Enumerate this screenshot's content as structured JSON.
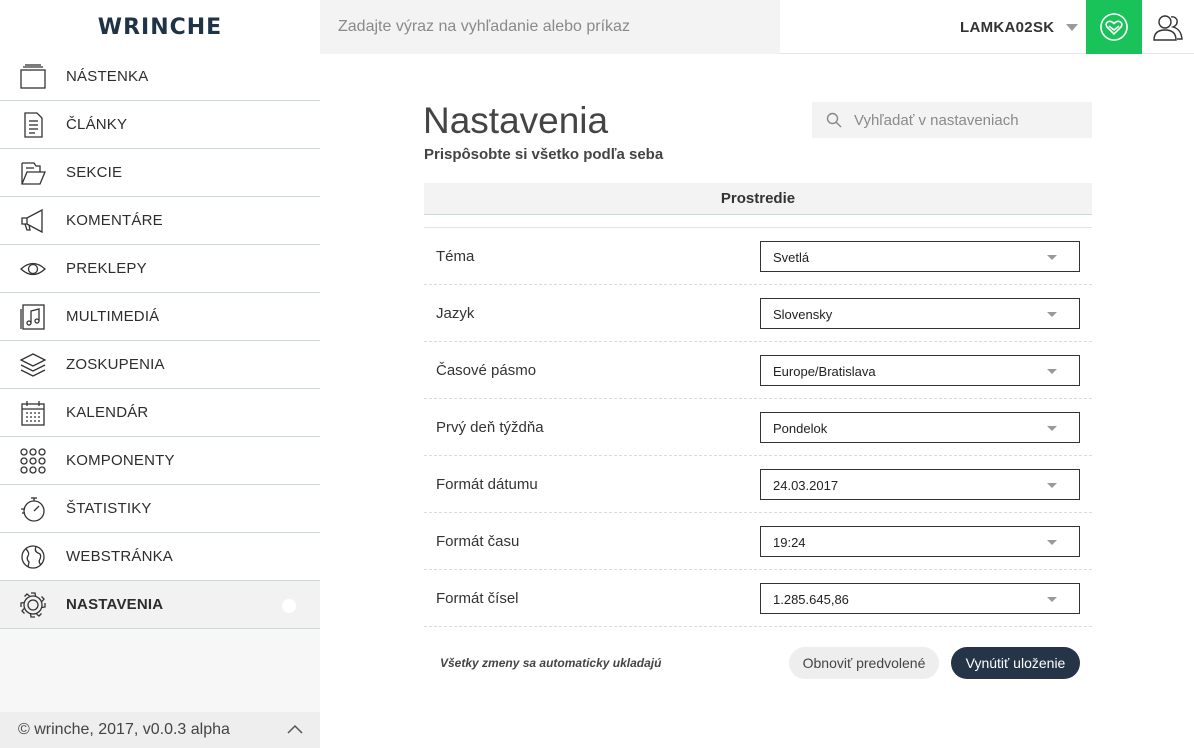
{
  "header": {
    "logo": "WRINCHE",
    "command_placeholder": "Zadajte výraz na vyhľadanie alebo príkaz",
    "username": "LAMKA02SK",
    "brand_button_icon": "heart-shield-icon",
    "profile_icon": "user-icon",
    "accent_color": "#19c35a"
  },
  "sidebar": {
    "items": [
      {
        "label": "NÁSTENKA",
        "icon": "dashboard-icon"
      },
      {
        "label": "ČLÁNKY",
        "icon": "document-icon"
      },
      {
        "label": "SEKCIE",
        "icon": "folder-icon"
      },
      {
        "label": "KOMENTÁRE",
        "icon": "megaphone-icon"
      },
      {
        "label": "PREKLEPY",
        "icon": "eye-icon"
      },
      {
        "label": "MULTIMEDIÁ",
        "icon": "music-icon"
      },
      {
        "label": "ZOSKUPENIA",
        "icon": "layers-icon"
      },
      {
        "label": "KALENDÁR",
        "icon": "calendar-icon"
      },
      {
        "label": "KOMPONENTY",
        "icon": "grid-dots-icon"
      },
      {
        "label": "ŠTATISTIKY",
        "icon": "stopwatch-icon"
      },
      {
        "label": "WEBSTRÁNKA",
        "icon": "globe-icon"
      },
      {
        "label": "NASTAVENIA",
        "icon": "gear-icon",
        "active": true
      }
    ],
    "footer": "© wrinche, 2017, v0.0.3 alpha"
  },
  "settings": {
    "title": "Nastavenia",
    "subtitle": "Prispôsobte si všetko podľa seba",
    "search_placeholder": "Vyhľadať v nastaveniach",
    "section": "Prostredie",
    "rows": [
      {
        "label": "Téma",
        "value": "Svetlá"
      },
      {
        "label": "Jazyk",
        "value": "Slovensky"
      },
      {
        "label": "Časové pásmo",
        "value": "Europe/Bratislava"
      },
      {
        "label": "Prvý deň týždňa",
        "value": "Pondelok"
      },
      {
        "label": "Formát dátumu",
        "value": "24.03.2017"
      },
      {
        "label": "Formát času",
        "value": "19:24"
      },
      {
        "label": "Formát čísel",
        "value": "1.285.645,86"
      }
    ],
    "autosave_note": "Všetky zmeny sa automaticky ukladajú",
    "reset_label": "Obnoviť predvolené",
    "save_label": "Vynútiť uloženie"
  }
}
